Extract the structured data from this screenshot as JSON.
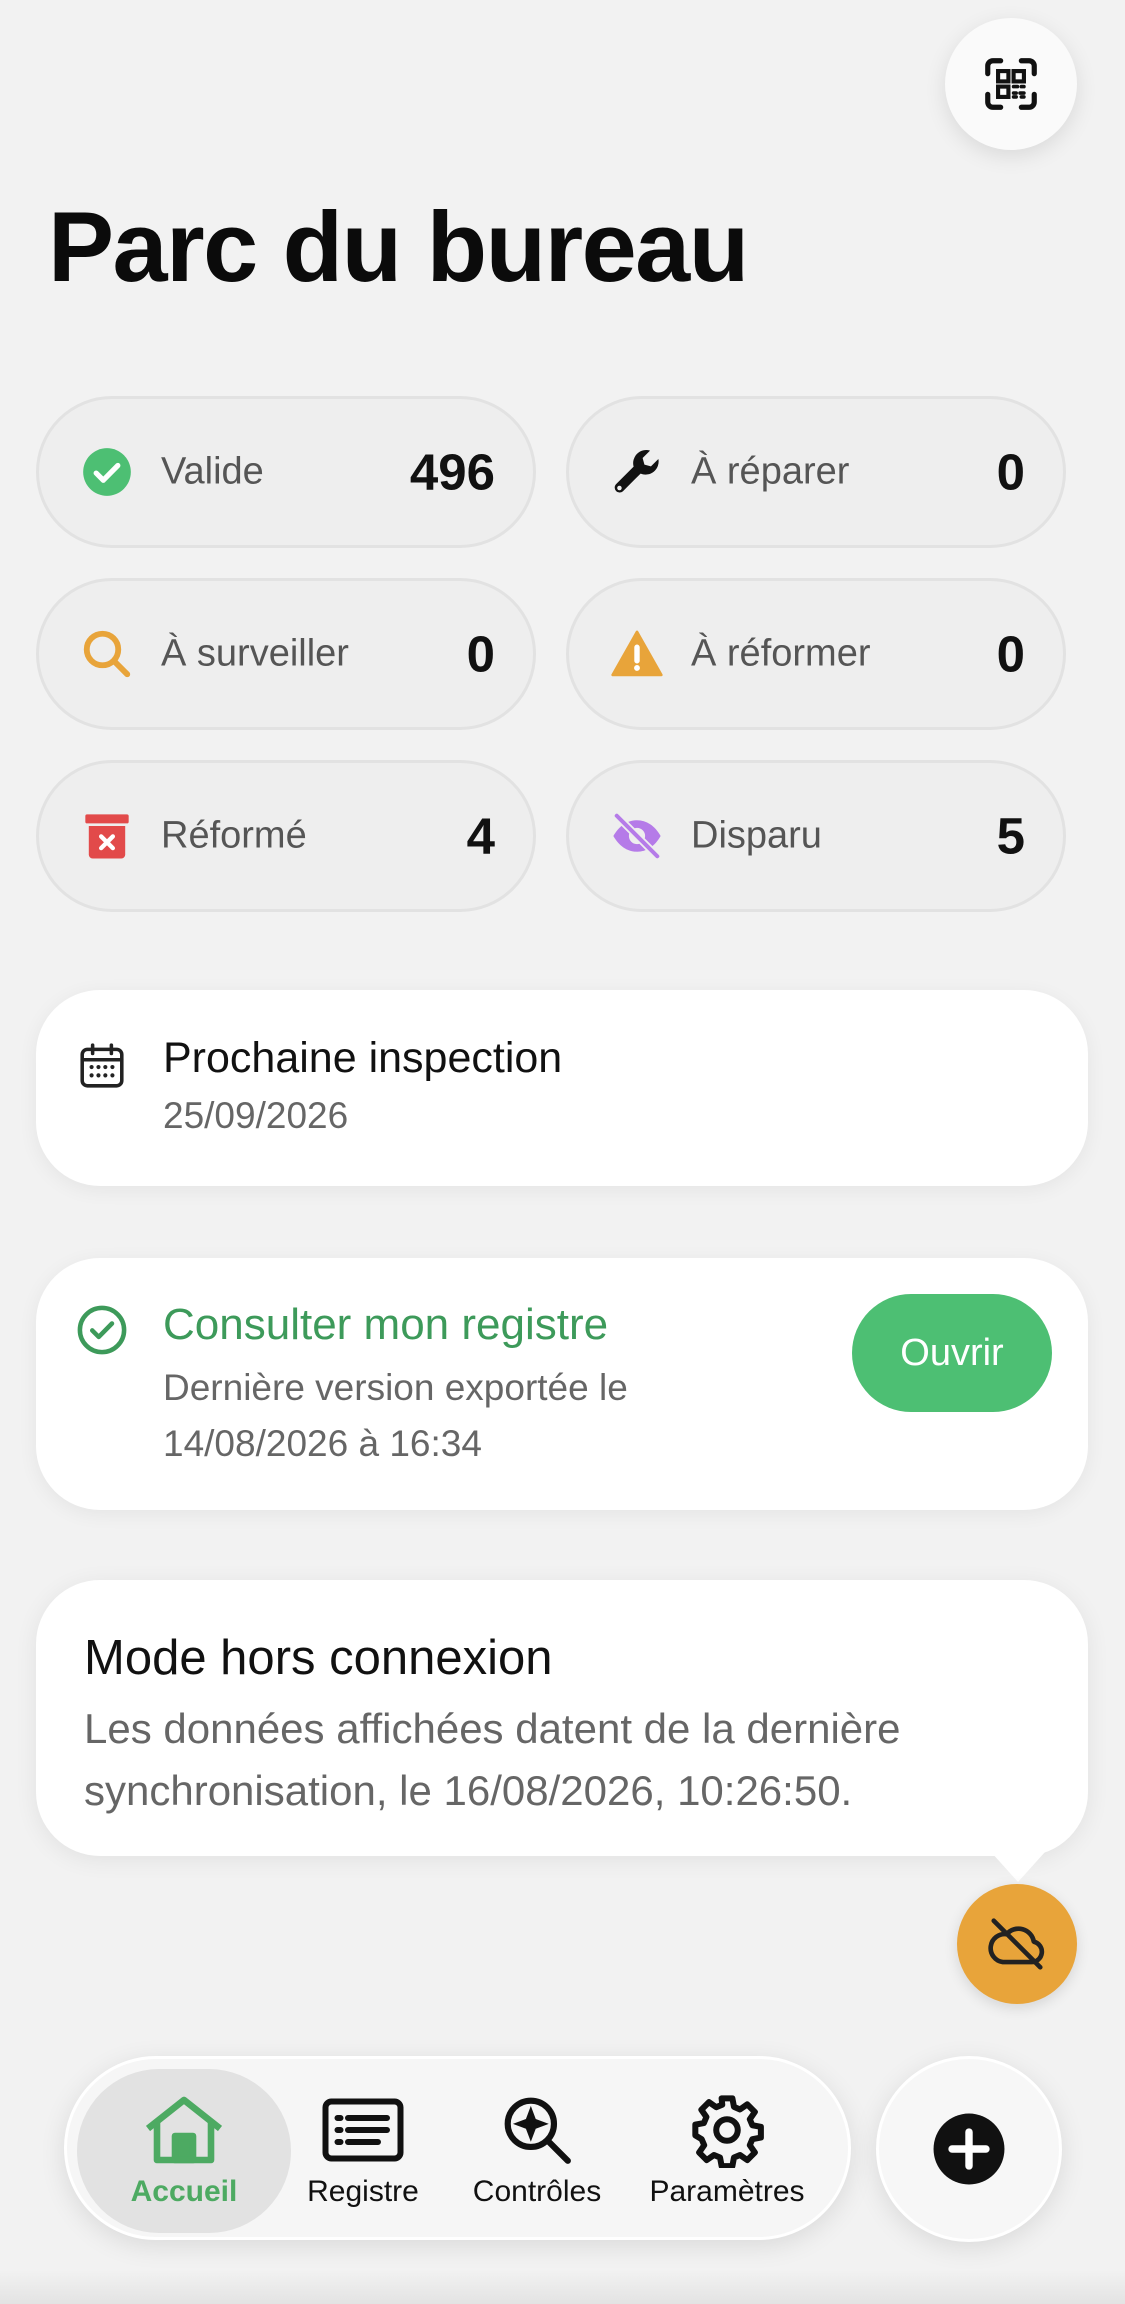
{
  "header": {
    "title": "Parc du bureau",
    "scan_icon": "qr-code-icon"
  },
  "stats": [
    {
      "label": "Valide",
      "value": "496",
      "icon": "check-circle-icon",
      "color": "#4dbf73"
    },
    {
      "label": "À réparer",
      "value": "0",
      "icon": "wrench-icon",
      "color": "#111111"
    },
    {
      "label": "À surveiller",
      "value": "0",
      "icon": "search-icon",
      "color": "#e8a43a"
    },
    {
      "label": "À réformer",
      "value": "0",
      "icon": "warning-icon",
      "color": "#e8a43a"
    },
    {
      "label": "Réformé",
      "value": "4",
      "icon": "trash-icon",
      "color": "#e24a4a"
    },
    {
      "label": "Disparu",
      "value": "5",
      "icon": "eye-off-icon",
      "color": "#b57be8"
    }
  ],
  "inspection": {
    "title": "Prochaine inspection",
    "date": "25/09/2026",
    "icon": "calendar-icon"
  },
  "registre": {
    "title": "Consulter mon registre",
    "subtitle_line1": "Dernière version exportée le",
    "subtitle_line2": "14/08/2026 à 16:34",
    "button": "Ouvrir",
    "icon": "check-circle-outline-icon",
    "accent": "#4dbf73"
  },
  "offline": {
    "title": "Mode hors connexion",
    "line1": "Les données affichées datent de la dernière",
    "line2": "synchronisation, le 16/08/2026, 10:26:50.",
    "icon": "cloud-off-icon",
    "color": "#e8a43a"
  },
  "nav": [
    {
      "label": "Accueil",
      "icon": "home-icon",
      "active": true
    },
    {
      "label": "Registre",
      "icon": "list-card-icon",
      "active": false
    },
    {
      "label": "Contrôles",
      "icon": "search-sparkle-icon",
      "active": false
    },
    {
      "label": "Paramètres",
      "icon": "gear-icon",
      "active": false
    }
  ],
  "add_icon": "plus-icon"
}
